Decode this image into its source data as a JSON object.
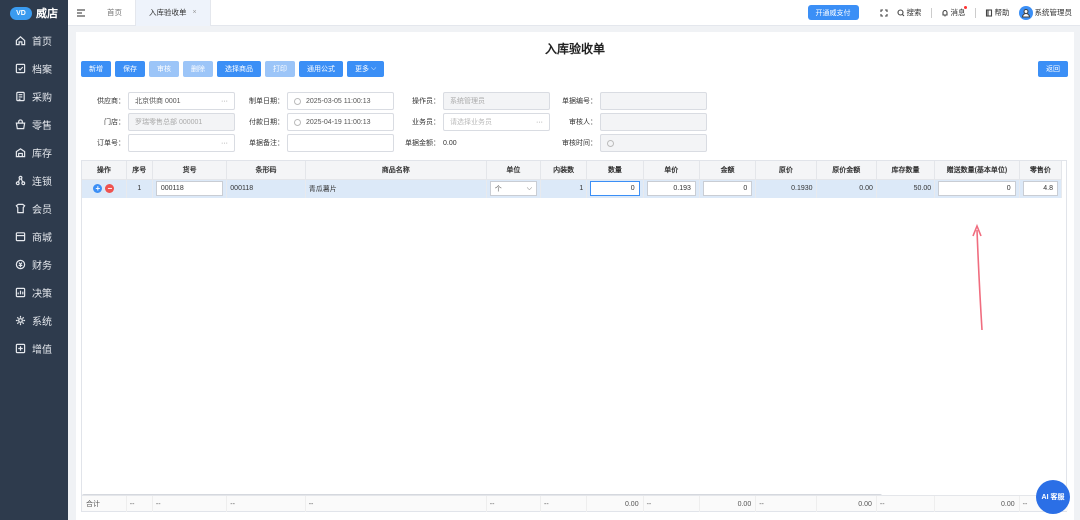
{
  "app": {
    "logo_mark": "VD",
    "name": "威店"
  },
  "sidebar": {
    "items": [
      {
        "label": "首页",
        "icon": "home-icon"
      },
      {
        "label": "档案",
        "icon": "archive-icon"
      },
      {
        "label": "采购",
        "icon": "purchase-icon"
      },
      {
        "label": "零售",
        "icon": "retail-icon"
      },
      {
        "label": "库存",
        "icon": "inventory-icon"
      },
      {
        "label": "连锁",
        "icon": "chain-icon"
      },
      {
        "label": "会员",
        "icon": "member-icon"
      },
      {
        "label": "商城",
        "icon": "mall-icon"
      },
      {
        "label": "财务",
        "icon": "finance-icon"
      },
      {
        "label": "决策",
        "icon": "decision-icon"
      },
      {
        "label": "系统",
        "icon": "system-icon"
      },
      {
        "label": "增值",
        "icon": "addon-icon"
      }
    ]
  },
  "tabs": {
    "home": "首页",
    "current": "入库验收单",
    "close": "×"
  },
  "topbar": {
    "pay": "开通威支付",
    "search": "搜索",
    "messages": "消息",
    "help": "帮助",
    "user": "系统管理员"
  },
  "page": {
    "title": "入库验收单"
  },
  "toolbar": {
    "add": "新增",
    "save": "保存",
    "audit": "审核",
    "delete": "删除",
    "select_goods": "选择商品",
    "print": "打印",
    "formula": "通用公式",
    "more": "更多",
    "back": "返回"
  },
  "form": {
    "supplier_label": "供应商：",
    "supplier_value": "北京供商 0001",
    "make_date_label": "制单日期：",
    "make_date_value": "2025-03-05 11:00:13",
    "operator_label": "操作员：",
    "operator_value": "系统管理员",
    "bill_no_label": "单据编号：",
    "bill_no_value": "",
    "store_label": "门店：",
    "store_value": "罗瑞零售总部 000001",
    "pay_date_label": "付款日期：",
    "pay_date_value": "2025-04-19 11:00:13",
    "salesman_label": "业务员：",
    "salesman_placeholder": "请选择业务员",
    "auditor_label": "审核人：",
    "auditor_value": "",
    "order_no_label": "订单号：",
    "order_no_value": "",
    "remark_label": "单据备注：",
    "remark_value": "",
    "amount_label": "单据金额：",
    "amount_value": "0.00",
    "audit_time_label": "审核时间："
  },
  "table": {
    "headers": [
      "操作",
      "序号",
      "货号",
      "条形码",
      "商品名称",
      "单位",
      "内装数",
      "数量",
      "单价",
      "金额",
      "原价",
      "原价金额",
      "库存数量",
      "赠送数量(基本单位)",
      "零售价"
    ],
    "rows": [
      {
        "index": "1",
        "code": "000118",
        "barcode": "000118",
        "name": "青瓜薯片",
        "unit": "个",
        "pack": "1",
        "qty": "0",
        "price": "0.193",
        "amount": "0",
        "orig_price": "0.1930",
        "orig_amount": "0.00",
        "stock": "50.00",
        "gift": "0",
        "retail": "4.8"
      }
    ],
    "summary": {
      "label": "合计",
      "dash": "--",
      "qty": "0.00",
      "amount": "0.00",
      "orig_amount": "0.00",
      "gift": "0.00"
    }
  },
  "ai_button": "AI 客服",
  "colors": {
    "primary": "#3b8ff6",
    "sidebar": "#2e3b4d",
    "arrow": "#f06d7f"
  }
}
